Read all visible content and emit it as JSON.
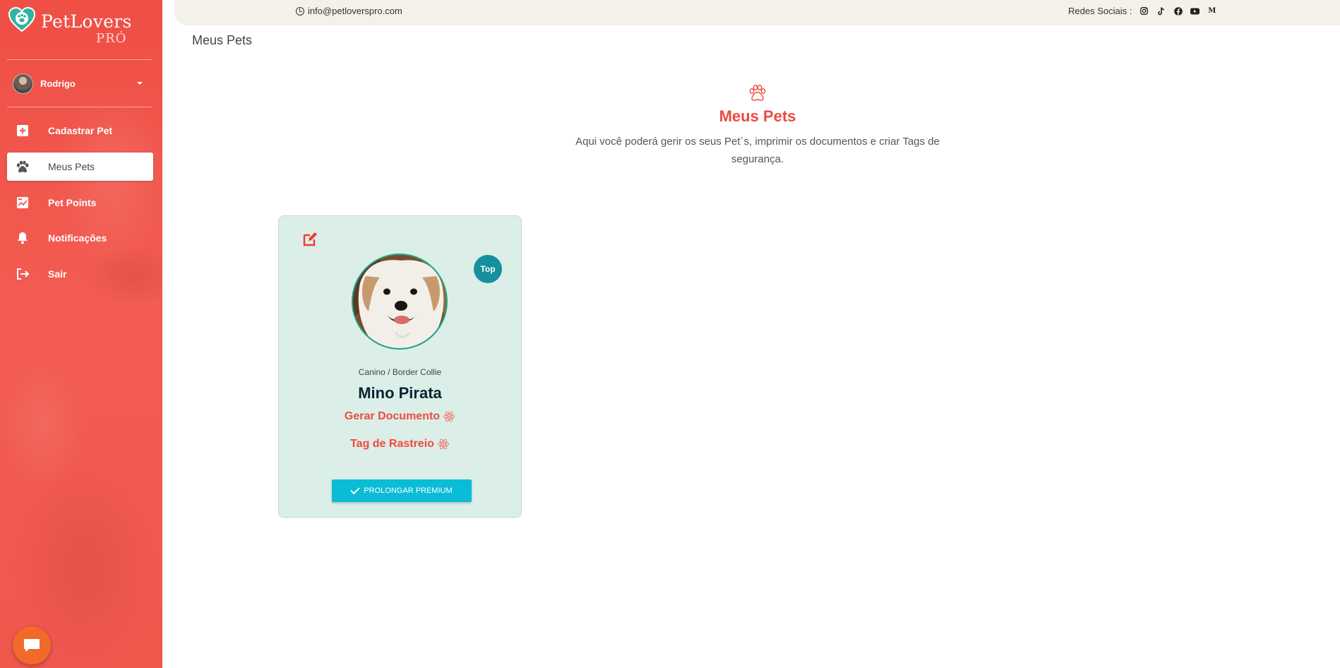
{
  "brand": {
    "name": "PetLovers",
    "sub": "PRÓ"
  },
  "user": {
    "name": "Rodrigo"
  },
  "nav": [
    {
      "label": "Cadastrar Pet",
      "icon": "plus-square-icon"
    },
    {
      "label": "Meus Pets",
      "icon": "paw-icon",
      "active": true
    },
    {
      "label": "Pet Points",
      "icon": "chart-icon"
    },
    {
      "label": "Notificações",
      "icon": "bell-icon"
    },
    {
      "label": "Sair",
      "icon": "logout-icon"
    }
  ],
  "topbar": {
    "email": "info@petloverspro.com",
    "social_label": "Redes Sociais :",
    "social_icons": [
      "instagram-icon",
      "tiktok-icon",
      "facebook-icon",
      "youtube-icon",
      "medium-icon"
    ]
  },
  "page": {
    "title": "Meus Pets",
    "section_title": "Meus Pets",
    "section_desc": "Aqui você poderá gerir os seus Pet´s, imprimir os documentos e criar Tags de segurança."
  },
  "pet_card": {
    "badge": "Top",
    "species_breed": "Canino / Border Collie",
    "name": "Mino Pirata",
    "doc_link": "Gerar Documento",
    "tag_link": "Tag de Rastreio",
    "premium_button": "PROLONGAR PREMIUM"
  },
  "colors": {
    "accent": "#ef4a3f",
    "sidebar": "#f25c52",
    "card_bg": "#dbeee8",
    "badge": "#17909d",
    "button": "#0bbcd6",
    "chat": "#f26a2a"
  }
}
